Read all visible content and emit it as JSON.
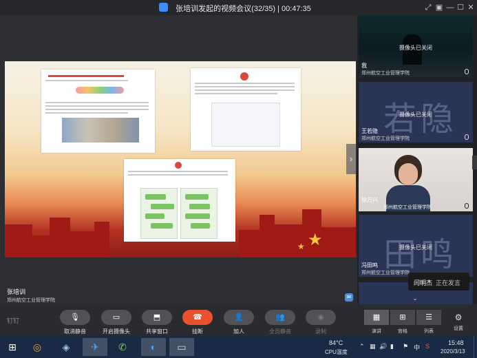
{
  "window": {
    "title": "张培训发起的视频会议(32/35) | 00:47:35"
  },
  "main": {
    "host_name": "张培训",
    "host_org": "郑州航空工业管理学院"
  },
  "participants": [
    {
      "name": "我",
      "org": "郑州航空工业管理学院",
      "status": "摄像头已关闭",
      "big_chars": ""
    },
    {
      "name": "王若隐",
      "org": "郑州航空工业管理学院",
      "status": "摄像头已关闭",
      "big_chars": "若隐"
    },
    {
      "name": "徐万兴",
      "org": "郑州航空工业管理学院",
      "status": "",
      "big_chars": ""
    },
    {
      "name": "冯田鸣",
      "org": "郑州航空工业管理学院",
      "status": "摄像头已关闭",
      "big_chars": "田鸣"
    }
  ],
  "speaking": {
    "name": "闫明杰",
    "status": "正在发言"
  },
  "toolbar": {
    "brand": "钉钉",
    "buttons": [
      {
        "label": "取消静音",
        "icon": "mic-muted-icon"
      },
      {
        "label": "开启摄像头",
        "icon": "camera-off-icon"
      },
      {
        "label": "共享窗口",
        "icon": "share-screen-icon"
      },
      {
        "label": "挂断",
        "icon": "hangup-icon"
      },
      {
        "label": "加人",
        "icon": "add-person-icon"
      },
      {
        "label": "全员静音",
        "icon": "mute-all-icon"
      },
      {
        "label": "录制",
        "icon": "record-icon"
      }
    ],
    "views": [
      {
        "label": "演讲",
        "icon": "speaker-view-icon"
      },
      {
        "label": "宫格",
        "icon": "grid-view-icon"
      },
      {
        "label": "列表",
        "icon": "list-view-icon"
      }
    ],
    "settings_label": "设置"
  },
  "taskbar": {
    "cpu_temp": "84°C",
    "cpu_label": "CPU温度",
    "ime": "中",
    "time": "15:48",
    "date": "2020/3/13"
  },
  "colors": {
    "hangup": "#e9502d",
    "tile_bg": "#2a3454",
    "taskbar": "#1a2a44"
  }
}
